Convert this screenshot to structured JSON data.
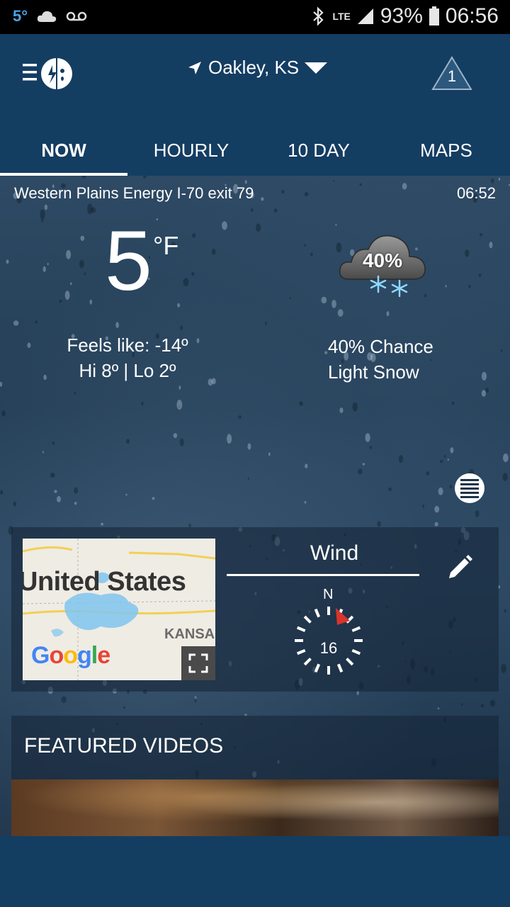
{
  "status_bar": {
    "temp": "5°",
    "network": "LTE",
    "battery": "93%",
    "time": "06:56"
  },
  "header": {
    "location": "Oakley, KS",
    "alert_count": "1",
    "tabs": [
      {
        "label": "NOW",
        "active": true
      },
      {
        "label": "HOURLY",
        "active": false
      },
      {
        "label": "10 DAY",
        "active": false
      },
      {
        "label": "MAPS",
        "active": false
      }
    ]
  },
  "current": {
    "station": "Western Plains Energy I-70 exit 79",
    "obs_time": "06:52",
    "temp": "5",
    "unit": "°F",
    "feels_like": "Feels like: -14º",
    "hi_lo": "Hi 8º | Lo 2º",
    "precip_pct": "40%",
    "chance_text": "40% Chance",
    "condition": "Light Snow"
  },
  "widget": {
    "map_country": "United States",
    "map_state": "KANSA",
    "map_brand": "Google",
    "wind_title": "Wind",
    "wind_dir_label": "N",
    "wind_speed": "16"
  },
  "featured": {
    "title": "FEATURED VIDEOS"
  },
  "colors": {
    "header_bg": "#143d62",
    "status_bg": "#000000",
    "compass_needle": "#d9342b"
  }
}
